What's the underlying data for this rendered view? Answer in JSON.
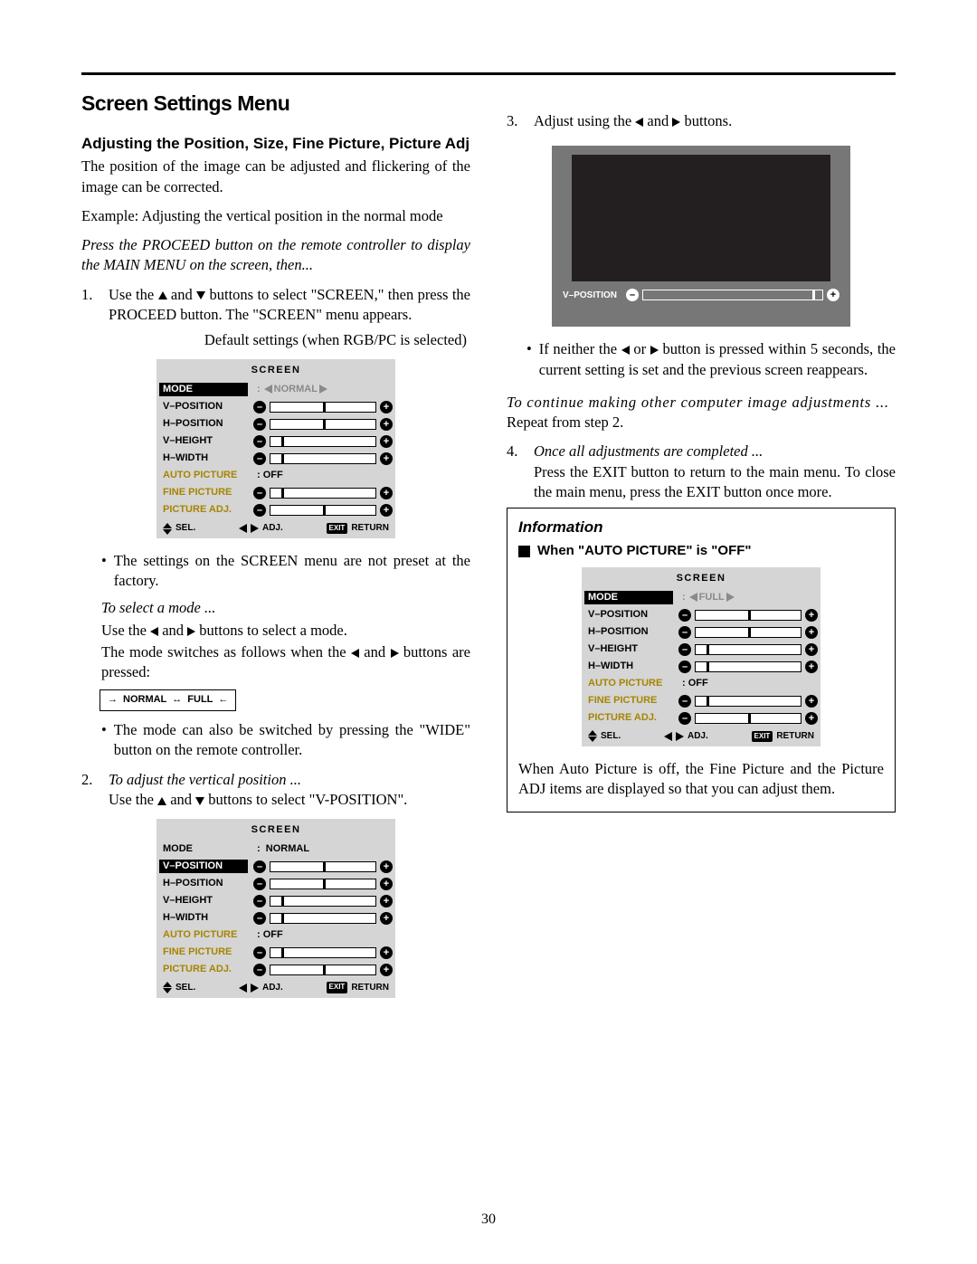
{
  "page_number": "30",
  "title": "Screen Settings Menu",
  "subhead": "Adjusting the Position, Size, Fine Picture, Picture Adj",
  "intro": "The position of the image can be adjusted and flickering of the image can be corrected.",
  "example": "Example: Adjusting the vertical position in the normal mode",
  "press_proceed": "Press the PROCEED button on the remote controller to display the MAIN MENU on the screen, then...",
  "step1": {
    "num": "1.",
    "a": "Use the ",
    "b": " and ",
    "c": " buttons to select \"SCREEN,\" then press the PROCEED button. The \"SCREEN\" menu appears.",
    "caption": "Default settings (when RGB/PC is selected)"
  },
  "osd": {
    "title": "SCREEN",
    "mode_label": "MODE",
    "mode_value": "NORMAL",
    "mode_value_full": "FULL",
    "items": [
      "V–POSITION",
      "H–POSITION",
      "V–HEIGHT",
      "H–WIDTH"
    ],
    "auto_label": "AUTO PICTURE",
    "auto_value": ":   OFF",
    "fine": "FINE PICTURE",
    "padj": "PICTURE ADJ.",
    "footer_sel": "SEL.",
    "footer_adj": "ADJ.",
    "footer_exit": "EXIT",
    "footer_return": "RETURN"
  },
  "note_not_preset": "The settings on the SCREEN menu are not preset at the factory.",
  "select_mode_head": "To select a mode ...",
  "select_mode_a": "Use the ",
  "select_mode_b": " and ",
  "select_mode_c": " buttons to select a mode.",
  "select_mode_d1": "The mode switches as follows when the ",
  "select_mode_d2": " and ",
  "select_mode_d3": " buttons are pressed:",
  "cycle": {
    "normal": "NORMAL",
    "full": "FULL"
  },
  "note_wide": "The mode can also be switched by pressing the \"WIDE\" button on the remote controller.",
  "step2": {
    "num": "2.",
    "head": "To adjust the vertical position ...",
    "a": "Use the ",
    "b": " and ",
    "c": " buttons to select \"V-POSITION\"."
  },
  "step3": {
    "num": "3.",
    "a": "Adjust using the ",
    "b": " and ",
    "c": " buttons."
  },
  "preview_label": "V–POSITION",
  "note_5sec_a": "If neither the ",
  "note_5sec_b": " or ",
  "note_5sec_c": " button is pressed within 5 seconds, the current setting is set and the previous screen reappears.",
  "continue_head": "To continue making other computer image adjustments ...",
  "continue_body": "Repeat from step 2.",
  "step4": {
    "num": "4.",
    "head": "Once all adjustments are completed ...",
    "body": "Press the EXIT button to return to the main menu. To close the main menu, press the EXIT button once more."
  },
  "info": {
    "title": "Information",
    "sub": "When \"AUTO PICTURE\" is \"OFF\"",
    "body": "When Auto Picture is off, the Fine Picture and the Picture ADJ items are displayed so that you can adjust them."
  }
}
